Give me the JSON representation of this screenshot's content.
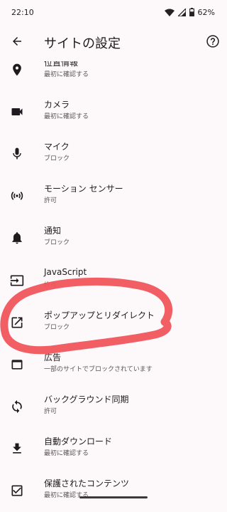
{
  "status_bar": {
    "time": "22:10",
    "battery": "62%",
    "battery_level": 0.62
  },
  "app_bar": {
    "title": "サイトの設定",
    "back_icon": "arrow-back-icon",
    "help_icon": "help-circle-icon"
  },
  "items": [
    {
      "id": "location",
      "icon": "location-pin-icon",
      "title": "位置情報",
      "subtitle": "最初に確認する"
    },
    {
      "id": "camera",
      "icon": "videocam-icon",
      "title": "カメラ",
      "subtitle": "最初に確認する"
    },
    {
      "id": "microphone",
      "icon": "mic-icon",
      "title": "マイク",
      "subtitle": "ブロック"
    },
    {
      "id": "motion-sensors",
      "icon": "sensors-icon",
      "title": "モーション センサー",
      "subtitle": "許可"
    },
    {
      "id": "notifications",
      "icon": "bell-icon",
      "title": "通知",
      "subtitle": "ブロック"
    },
    {
      "id": "javascript",
      "icon": "input-icon",
      "title": "JavaScript",
      "subtitle": "許可"
    },
    {
      "id": "popups",
      "icon": "open-in-new-icon",
      "title": "ポップアップとリダイレクト",
      "subtitle": "ブロック"
    },
    {
      "id": "ads",
      "icon": "web-asset-icon",
      "title": "広告",
      "subtitle": "一部のサイトでブロックされています"
    },
    {
      "id": "background-sync",
      "icon": "sync-icon",
      "title": "バックグラウンド同期",
      "subtitle": "許可"
    },
    {
      "id": "auto-download",
      "icon": "download-icon",
      "title": "自動ダウンロード",
      "subtitle": "最初に確認する"
    },
    {
      "id": "protected-content",
      "icon": "check-box-icon",
      "title": "保護されたコンテンツ",
      "subtitle": "最初に確認する"
    }
  ],
  "colors": {
    "background": "#fdf8fa",
    "text": "#1f1a1d",
    "subtext": "#5c5458",
    "annotation": "#f0555c"
  }
}
